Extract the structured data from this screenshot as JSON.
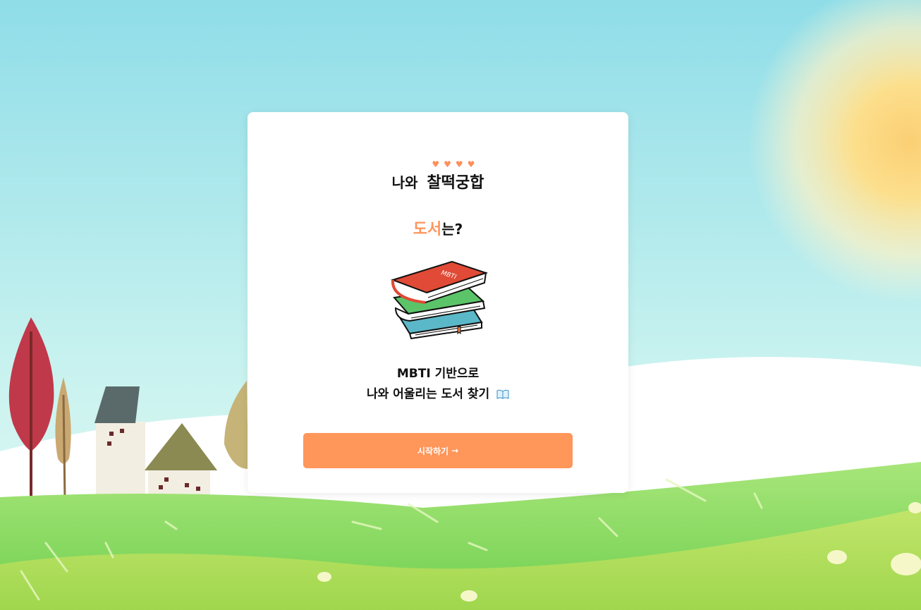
{
  "card": {
    "line1_prefix": "나와",
    "line1_accent": "찰떡궁합",
    "hearts": "♥♥♥♥",
    "line2_highlight": "도서",
    "line2_suffix": "는?",
    "book_cover_text": "MBTI",
    "desc_line1": "MBTI 기반으로",
    "desc_line2": "나와 어울리는 도서 찾기",
    "start_button_label": "시작하기",
    "start_button_icon": "→"
  },
  "colors": {
    "accent": "#ff955c",
    "button": "#ff965a"
  }
}
